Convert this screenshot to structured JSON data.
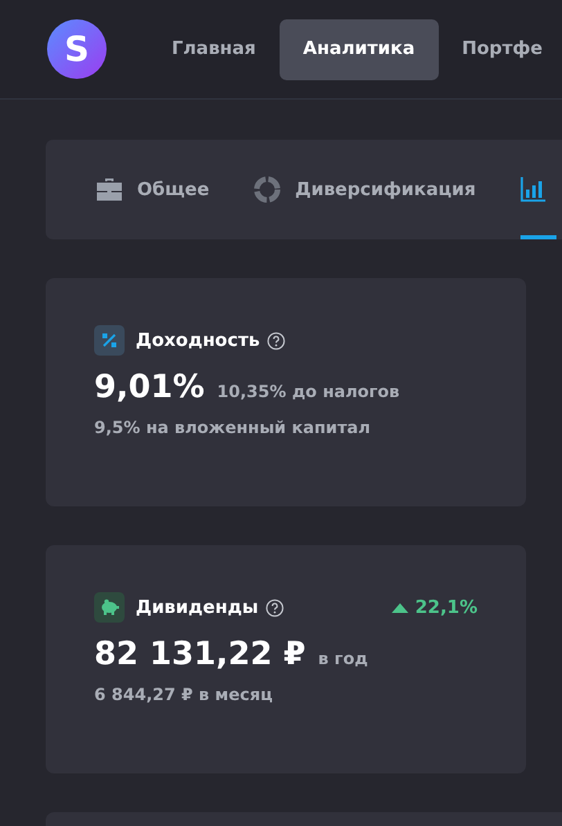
{
  "logo": {
    "letter": "S"
  },
  "nav": [
    {
      "label": "Главная",
      "selected": false
    },
    {
      "label": "Аналитика",
      "selected": true
    },
    {
      "label": "Портфе",
      "selected": false
    }
  ],
  "tabs": [
    {
      "label": "Общее",
      "kind": "briefcase",
      "selected": false
    },
    {
      "label": "Диверсификация",
      "kind": "donut",
      "selected": false
    },
    {
      "kind": "bars",
      "selected": true
    }
  ],
  "cards": [
    {
      "title": "Доходность",
      "kind": "percent",
      "main": "9,01%",
      "main_note": "10,35% до налогов",
      "sub": "9,5% на вложенный капитал"
    },
    {
      "title": "Дивиденды",
      "kind": "piggy",
      "change": {
        "kind": "rise",
        "value": "22,1%"
      },
      "main": "82 131,22 ₽",
      "main_note": "в год",
      "sub": "6 844,27 ₽ в месяц"
    }
  ]
}
